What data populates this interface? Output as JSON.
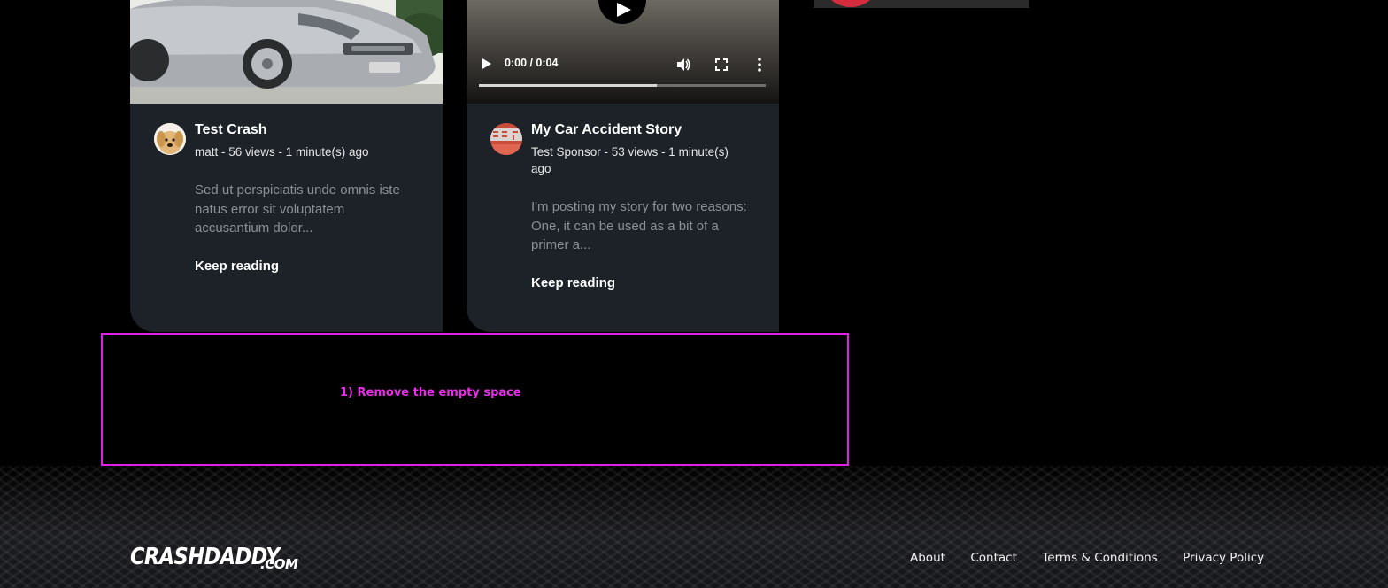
{
  "posts": [
    {
      "title": "Test Crash",
      "meta": "matt - 56 views - 1 minute(s) ago",
      "excerpt": "Sed ut perspiciatis unde omnis iste natus error sit voluptatem accusantium dolor...",
      "cta": "Keep reading"
    },
    {
      "title": "My Car Accident Story",
      "meta": "Test Sponsor - 53 views - 1 minute(s) ago",
      "excerpt": "I'm posting my story for two reasons: One, it can be used as a bit of a primer a...",
      "cta": "Keep reading"
    }
  ],
  "video": {
    "time": "0:00 / 0:04",
    "progress_percent": 62
  },
  "annotation": {
    "text": "1) Remove the empty space",
    "color": "#e020e8"
  },
  "footer": {
    "logo_main": "CRASHDADDY",
    "logo_suffix": ".COM",
    "links": [
      "About",
      "Contact",
      "Terms & Conditions",
      "Privacy Policy"
    ]
  },
  "colors": {
    "card_bg": "#1d2228",
    "accent_red": "#d62b3c"
  },
  "icons": [
    "play-icon",
    "volume-icon",
    "fullscreen-icon",
    "more-options-icon"
  ]
}
